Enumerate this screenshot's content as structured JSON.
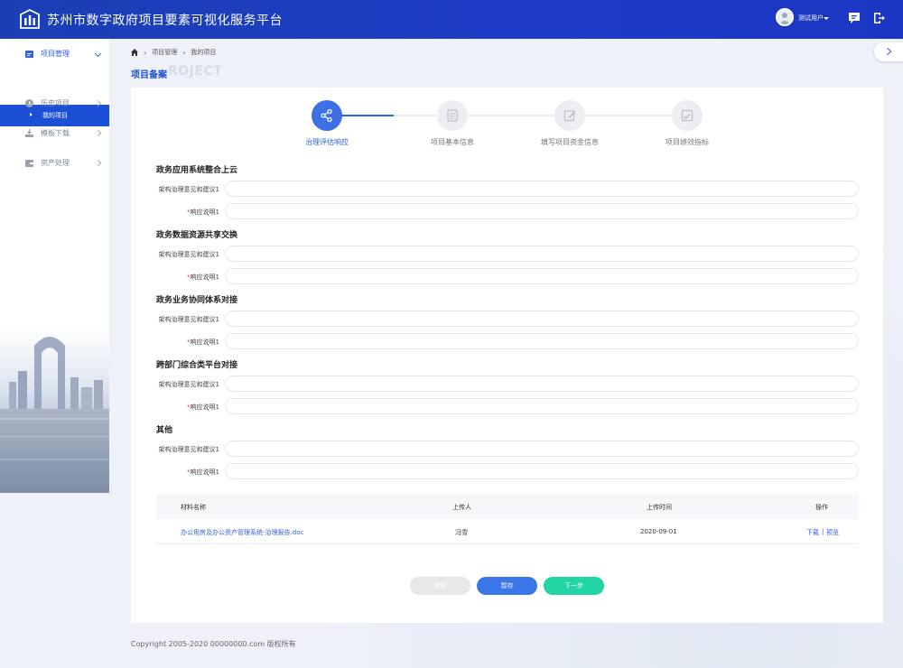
{
  "header": {
    "title": "苏州市数字政府项目要素可视化服务平台",
    "user_name": "测试用户",
    "icons": [
      "logo-icon",
      "message-icon",
      "logout-icon"
    ]
  },
  "sidebar": {
    "items": [
      {
        "label": "项目管理",
        "icon": "folder-icon",
        "expanded": true
      },
      {
        "label": "历史项目",
        "icon": "clock-icon"
      },
      {
        "label": "模板下载",
        "icon": "download-icon"
      },
      {
        "label": "资产处理",
        "icon": "wallet-icon"
      }
    ],
    "sub_item": "我的项目"
  },
  "breadcrumb": {
    "items": [
      "项目管理",
      "我的项目"
    ]
  },
  "page": {
    "title": "项目备案",
    "title_bg": "ROJECT"
  },
  "steps": [
    {
      "label": "治理评估响应",
      "active": true
    },
    {
      "label": "项目基本信息",
      "active": false
    },
    {
      "label": "填写项目资金信息",
      "active": false
    },
    {
      "label": "项目绩效指标",
      "active": false
    }
  ],
  "form": {
    "sections": [
      {
        "title": "政务应用系统整合上云",
        "label_a": "架构治理意见和建议1",
        "label_b": "响应说明1"
      },
      {
        "title": "政务数据资源共享交换",
        "label_a": "架构治理意见和建议1",
        "label_b": "响应说明1"
      },
      {
        "title": "政务业务协同体系对接",
        "label_a": "架构治理意见和建议1",
        "label_b": "响应说明1"
      },
      {
        "title": "跨部门综合类平台对接",
        "label_a": "架构治理意见和建议1",
        "label_b": "响应说明1"
      },
      {
        "title": "其他",
        "label_a": "架构治理意见和建议1",
        "label_b": "响应说明1"
      }
    ],
    "required_mark": "*"
  },
  "table": {
    "headers": [
      "材料名称",
      "上传人",
      "上传时间",
      "操作"
    ],
    "rows": [
      {
        "name": "办公用房及办公资产管理系统-治理报告.doc",
        "uploader": "冯雪",
        "time": "2020-09-01",
        "action_download": "下载",
        "action_sep": "|",
        "action_preview": "预览"
      }
    ]
  },
  "buttons": {
    "back": "返回",
    "save": "暂存",
    "next": "下一步"
  },
  "footer": {
    "copyright": "Copyright 2005-2020 00000000.com 版权所有"
  },
  "colors": {
    "header_bg": "#1e3cc7",
    "accent": "#2b5fe4",
    "next_btn": "#22d5a4",
    "save_btn": "#3b76e8"
  }
}
